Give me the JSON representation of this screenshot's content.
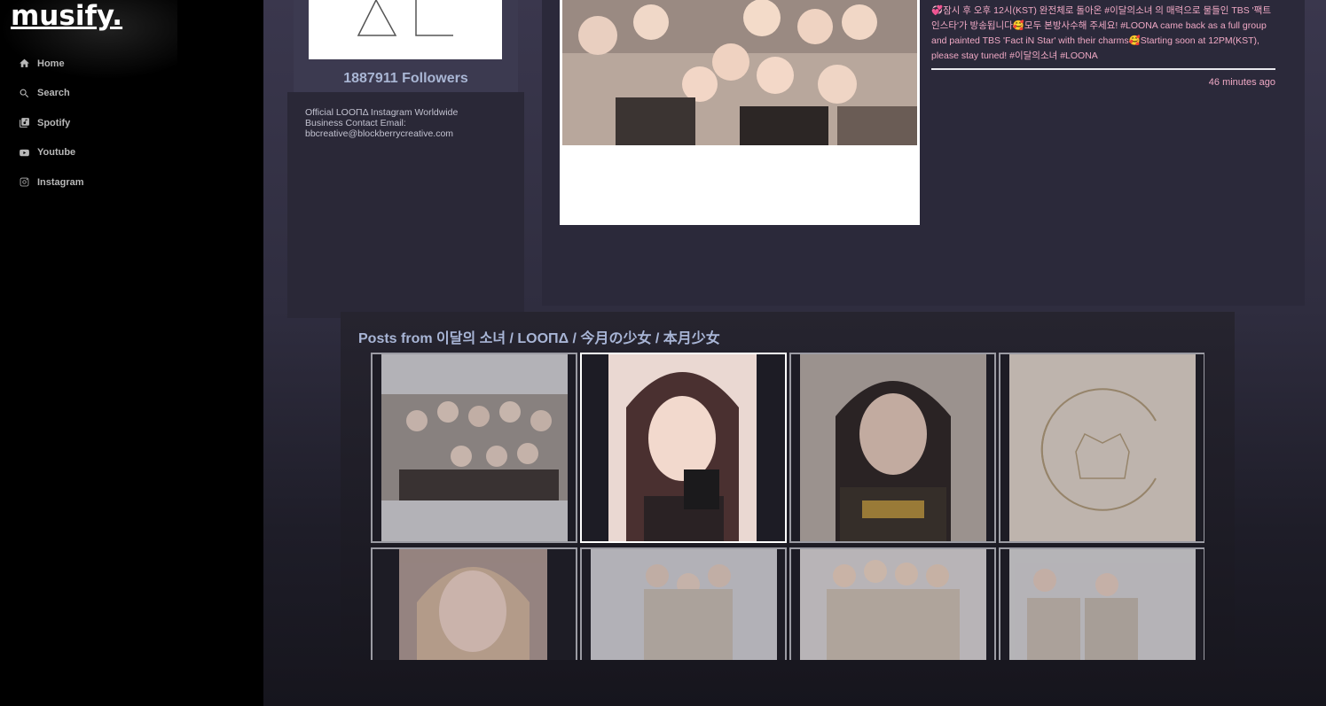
{
  "app": {
    "logo": "musify."
  },
  "sidebar": {
    "items": [
      {
        "label": "Home",
        "icon": "home-icon"
      },
      {
        "label": "Search",
        "icon": "search-icon"
      },
      {
        "label": "Spotify",
        "icon": "library-icon"
      },
      {
        "label": "Youtube",
        "icon": "youtube-icon"
      },
      {
        "label": "Instagram",
        "icon": "instagram-icon"
      }
    ]
  },
  "profile": {
    "followers": "1887911 Followers",
    "bio_line1": "Official LOOΠΔ Instagram Worldwide",
    "bio_line2": "Business Contact Email:",
    "bio_line3": "bbcreative@blockberrycreative.com"
  },
  "post": {
    "caption": "💞잠시 후 오후 12시(KST) 완전체로 돌아온 #이달의소녀 의 매력으로 물들인 TBS '팩트인스타'가 방송됩니다🥰모두 본방사수해 주세요! #LOONA came back as a full group and painted TBS 'Fact iN Star' with their charms🥰Starting soon at 12PM(KST), please stay tuned! #이달의소녀 #LOONA",
    "timestamp": "46 minutes ago"
  },
  "posts_section": {
    "title": "Posts from 이달의 소녀 / LOOΠΔ / 今月の少女 / 本月少女"
  },
  "colors": {
    "accent_text": "#a8b5d6",
    "caption_pink": "#f0a9c5",
    "selected_border": "#ffffff"
  }
}
